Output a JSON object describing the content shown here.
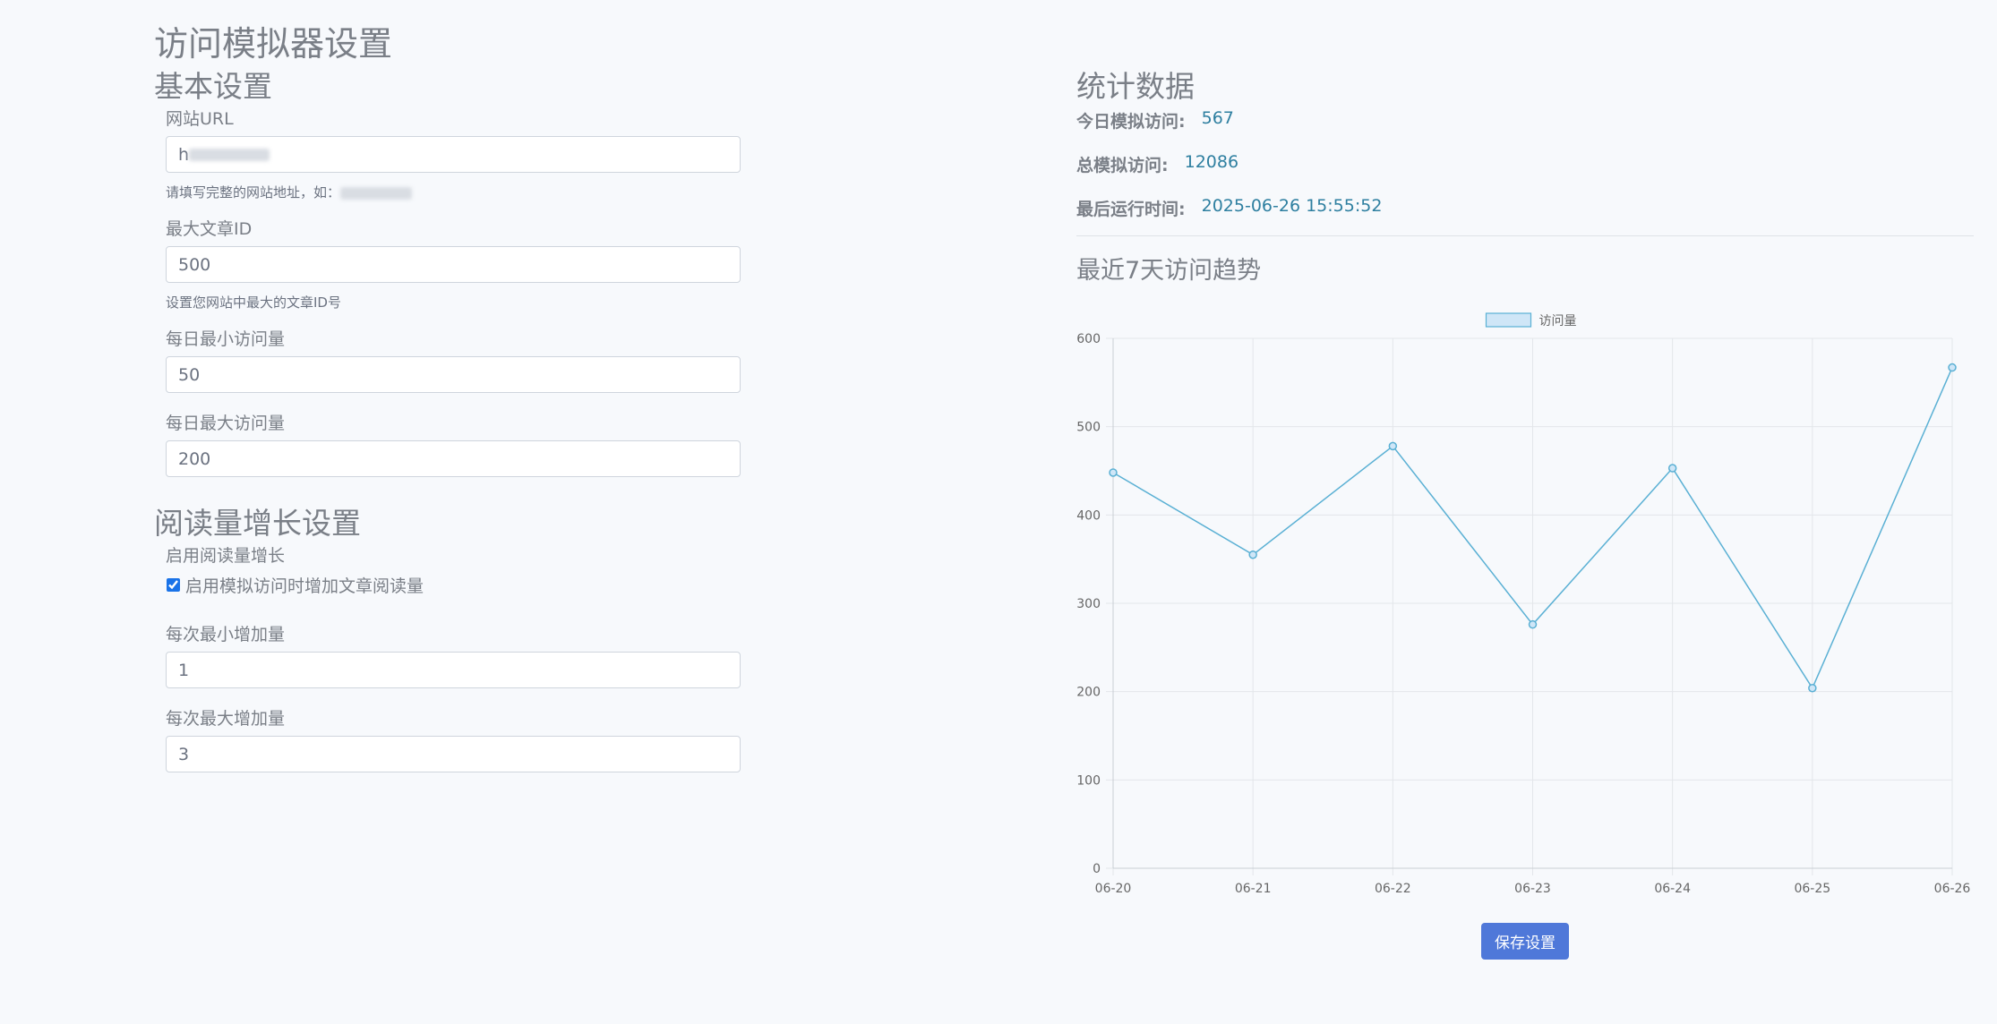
{
  "page": {
    "title": "访问模拟器设置"
  },
  "basic": {
    "title": "基本设置",
    "url_label": "网站URL",
    "url_value": "h",
    "url_help": "请填写完整的网站地址，如：",
    "max_id_label": "最大文章ID",
    "max_id_value": "500",
    "max_id_help": "设置您网站中最大的文章ID号",
    "min_daily_label": "每日最小访问量",
    "min_daily_value": "50",
    "max_daily_label": "每日最大访问量",
    "max_daily_value": "200"
  },
  "growth": {
    "title": "阅读量增长设置",
    "enable_label": "启用阅读量增长",
    "enable_checkbox_label": "启用模拟访问时增加文章阅读量",
    "enabled": true,
    "min_inc_label": "每次最小增加量",
    "min_inc_value": "1",
    "max_inc_label": "每次最大增加量",
    "max_inc_value": "3"
  },
  "stats": {
    "title": "统计数据",
    "today_label": "今日模拟访问:",
    "today_value": "567",
    "total_label": "总模拟访问:",
    "total_value": "12086",
    "last_run_label": "最后运行时间:",
    "last_run_value": "2025-06-26 15:55:52",
    "trend_title": "最近7天访问趋势"
  },
  "chart_data": {
    "type": "line",
    "categories": [
      "06-20",
      "06-21",
      "06-22",
      "06-23",
      "06-24",
      "06-25",
      "06-26"
    ],
    "series": [
      {
        "name": "访问量",
        "values": [
          448,
          355,
          478,
          276,
          453,
          204,
          567
        ]
      }
    ],
    "ylim": [
      0,
      600
    ],
    "yticks": [
      0,
      100,
      200,
      300,
      400,
      500,
      600
    ],
    "grid": true,
    "legend": "top-center",
    "line_color": "#5ab0d4",
    "fill_color": "#cfe6f7"
  },
  "actions": {
    "save_label": "保存设置"
  },
  "colors": {
    "accent": "#4f78d9",
    "value": "#2e7fa0"
  }
}
